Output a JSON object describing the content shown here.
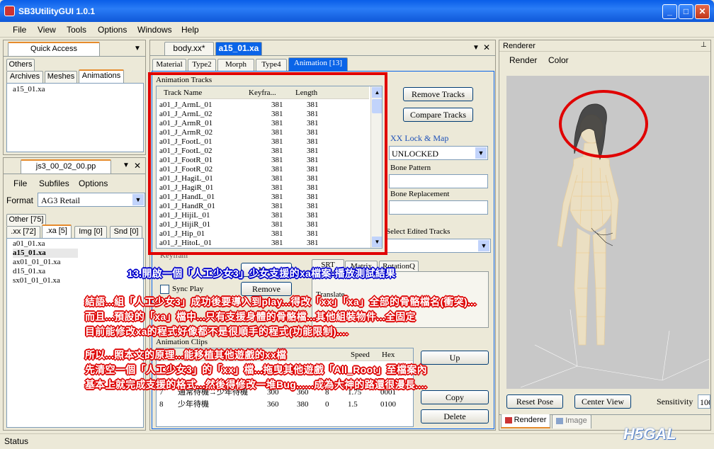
{
  "window": {
    "title": "SB3UtilityGUI 1.0.1",
    "min": "_",
    "max": "□",
    "close": "✕"
  },
  "menu": [
    "File",
    "View",
    "Tools",
    "Options",
    "Windows",
    "Help"
  ],
  "quick_access": {
    "title": "Quick Access",
    "tabs_row1": [
      "Others"
    ],
    "tabs_row2": [
      "Archives",
      "Meshes",
      "Animations"
    ],
    "items": [
      "a15_01.xa"
    ]
  },
  "pp_panel": {
    "tab": "js3_00_02_00.pp",
    "menu": [
      "File",
      "Subfiles",
      "Options"
    ],
    "format_label": "Format",
    "format_value": "AG3 Retail",
    "tabs_row1": [
      "Other [75]"
    ],
    "tabs_row2": [
      ".xx [72]",
      ".xa [5]",
      "Img [0]",
      "Snd [0]"
    ],
    "files": [
      "a01_01.xa",
      "a15_01.xa",
      "ax01_01_01.xa",
      "d15_01.xa",
      "sx01_01_01.xa"
    ]
  },
  "editor": {
    "doc_tabs": [
      "body.xx*",
      "a15_01.xa"
    ],
    "sub_tabs": [
      "Material",
      "Type2",
      "Morph",
      "Type4",
      "Animation [13]"
    ],
    "tracks_title": "Animation Tracks",
    "columns": [
      "Track Name",
      "Keyfra...",
      "Length"
    ],
    "tracks": [
      [
        "a01_J_ArmL_01",
        "381",
        "381"
      ],
      [
        "a01_J_ArmL_02",
        "381",
        "381"
      ],
      [
        "a01_J_ArmR_01",
        "381",
        "381"
      ],
      [
        "a01_J_ArmR_02",
        "381",
        "381"
      ],
      [
        "a01_J_FootL_01",
        "381",
        "381"
      ],
      [
        "a01_J_FootL_02",
        "381",
        "381"
      ],
      [
        "a01_J_FootR_01",
        "381",
        "381"
      ],
      [
        "a01_J_FootR_02",
        "381",
        "381"
      ],
      [
        "a01_J_HagiL_01",
        "381",
        "381"
      ],
      [
        "a01_J_HagiR_01",
        "381",
        "381"
      ],
      [
        "a01_J_HandL_01",
        "381",
        "381"
      ],
      [
        "a01_J_HandR_01",
        "381",
        "381"
      ],
      [
        "a01_J_HijiL_01",
        "381",
        "381"
      ],
      [
        "a01_J_HijiR_01",
        "381",
        "381"
      ],
      [
        "a01_J_Hip_01",
        "381",
        "381"
      ],
      [
        "a01_J_HitoL_01",
        "381",
        "381"
      ]
    ],
    "remove_tracks": "Remove Tracks",
    "compare_tracks": "Compare Tracks",
    "lock_map_label": "XX Lock & Map",
    "lock_value": "UNLOCKED",
    "bone_pattern": "Bone Pattern",
    "bone_replacement": "Bone Replacement",
    "select_edited": "Select Edited Tracks",
    "keyframe_label": "Keyfram",
    "new_btn": "New",
    "remove_btn": "Remove",
    "sync_play": "Sync Play",
    "srt_tabs": [
      "SRT",
      "Matrix",
      "RotationQ"
    ],
    "translate": "Translate",
    "clips_title": "Animation Clips",
    "clip_cols": [
      "Speed",
      "Hex"
    ],
    "clips": [
      [
        "7",
        "通常待機→少年待機",
        "300",
        "360",
        "8",
        "1.75",
        "0001"
      ],
      [
        "8",
        "少年待機",
        "360",
        "380",
        "0",
        "1.5",
        "0100"
      ]
    ],
    "clip_row_top": [
      "130"
    ],
    "up": "Up",
    "copy": "Copy",
    "delete": "Delete"
  },
  "renderer": {
    "title": "Renderer",
    "menu": [
      "Render",
      "Color"
    ],
    "reset_pose": "Reset Pose",
    "center_view": "Center View",
    "sensitivity": "Sensitivity",
    "sensitivity_value": "100",
    "tabs": [
      "Renderer",
      "Image"
    ]
  },
  "status": "Status",
  "overlay": {
    "caption": "13.開啟一個「人工少女3」少女支援的xa檔案-播放測試結果",
    "para1": [
      "結語...組「人工少女3」成功後要導入到play...得改「xx」「xa」全部的骨骼檔名(衝突)...",
      "而且...預設的「xa」檔中...只有支援身體的骨骼檔...其他組裝物件...全固定",
      "目前能修改xa的程式好像都不是很順手的程式(功能限制)...."
    ],
    "para2": [
      "所以...照本文的原理...能移植其他遊戲的xx檔",
      "先清空一個「人工少女3」的「xx」檔...拖曳其他遊戲「All_Root」至檔案內",
      "基本上就完成支援的格式...然後得修改一堆Bug......成為大神的路還很漫長...."
    ]
  },
  "watermark": "H5GAL",
  "colors": {
    "titlebar": "#0a5ee8",
    "accent_tab": "#0a64e8",
    "highlight": "#e00000",
    "viewport": "#c8c8c8"
  }
}
